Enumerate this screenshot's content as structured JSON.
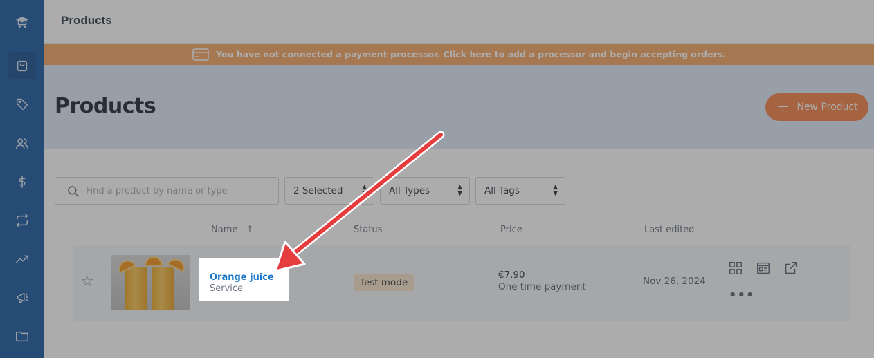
{
  "header": {
    "title": "Products"
  },
  "banner": {
    "text": "You have not connected a payment processor. Click here to add a processor and begin accepting orders."
  },
  "page": {
    "title": "Products",
    "new_button": "New Product"
  },
  "filters": {
    "search_placeholder": "Find a product by name or type",
    "status_select": "2 Selected",
    "type_select": "All Types",
    "tag_select": "All Tags"
  },
  "table": {
    "columns": {
      "name": "Name",
      "sort_indicator": "↑",
      "status": "Status",
      "price": "Price",
      "last_edited": "Last edited"
    },
    "rows": [
      {
        "name": "Orange juice",
        "type": "Service",
        "status": "Test mode",
        "price": "€7.90",
        "price_type": "One time payment",
        "last_edited": "Nov 26, 2024"
      }
    ]
  },
  "sidebar": {
    "items": [
      "logo-icon",
      "bag-icon",
      "tag-icon",
      "users-icon",
      "dollar-icon",
      "repeat-icon",
      "trending-icon",
      "megaphone-icon",
      "folder-icon"
    ]
  },
  "colors": {
    "sidebar": "#0b4f9c",
    "banner": "#f5a05a",
    "accent": "#f37a3c",
    "link": "#1b78c8",
    "arrow": "#e53d3d"
  }
}
